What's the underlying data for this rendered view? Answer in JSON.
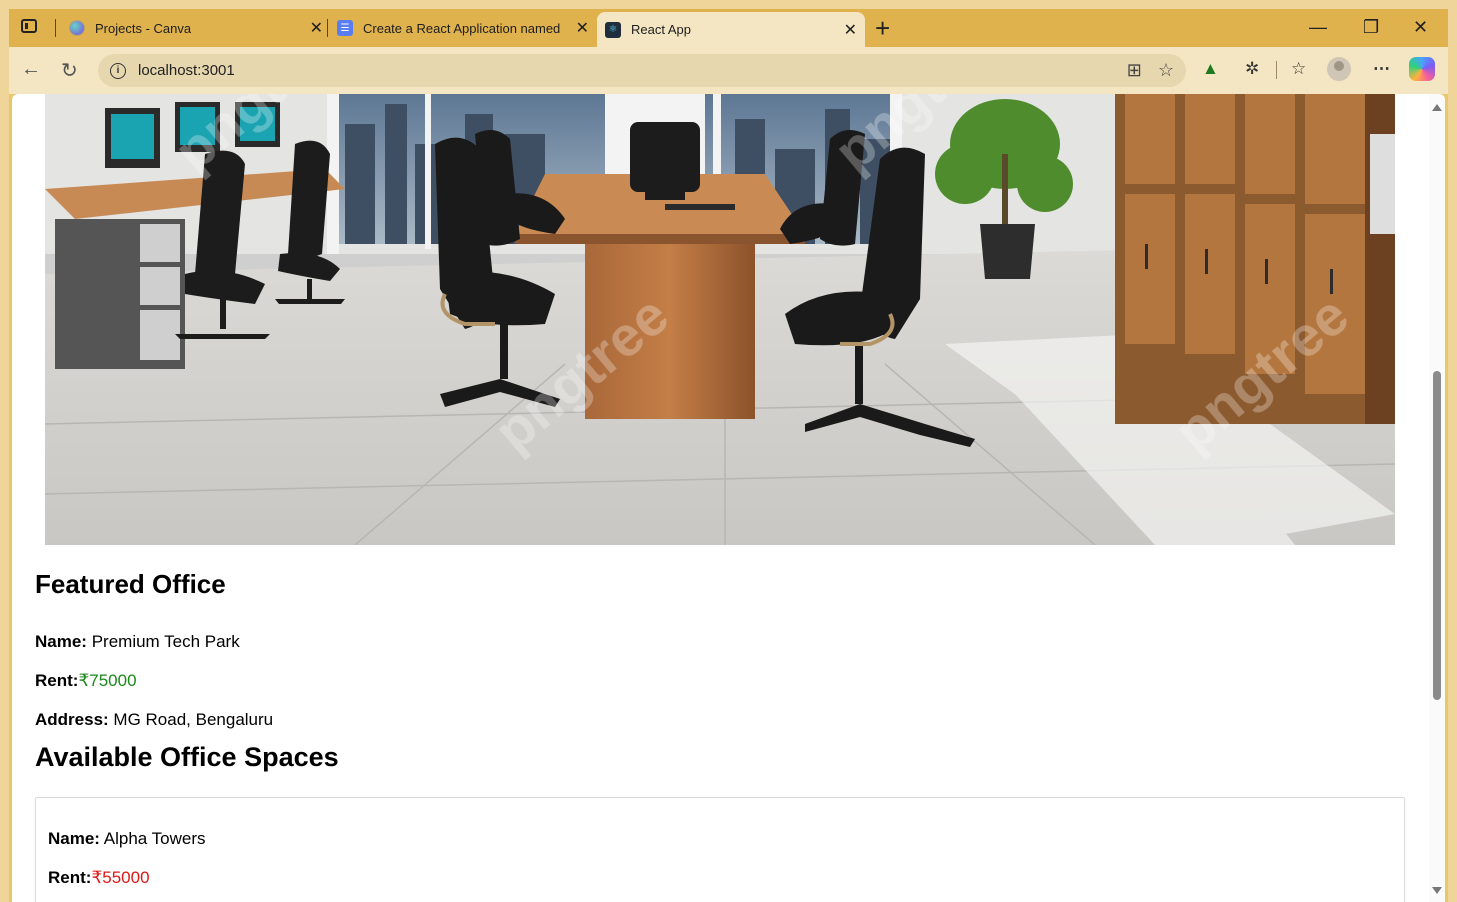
{
  "browser": {
    "tabs": [
      {
        "title": "Projects - Canva",
        "favicon": "canva-icon",
        "active": false
      },
      {
        "title": "Create a React Application named",
        "favicon": "document-icon",
        "active": false
      },
      {
        "title": "React App",
        "favicon": "react-icon",
        "active": true
      }
    ],
    "url": "localhost:3001",
    "accent": "#dfb24e"
  },
  "hero": {
    "watermark": "pngtree"
  },
  "featured": {
    "heading": "Featured Office",
    "name_label": "Name:",
    "name_value": "Premium Tech Park",
    "rent_label": "Rent:",
    "rent_value": "₹75000",
    "address_label": "Address:",
    "address_value": "MG Road, Bengaluru",
    "rent_color": "#1b8a1b"
  },
  "available": {
    "heading": "Available Office Spaces",
    "items": [
      {
        "name_label": "Name:",
        "name_value": "Alpha Towers",
        "rent_label": "Rent:",
        "rent_value": "₹55000",
        "rent_color": "#e01818"
      }
    ]
  }
}
